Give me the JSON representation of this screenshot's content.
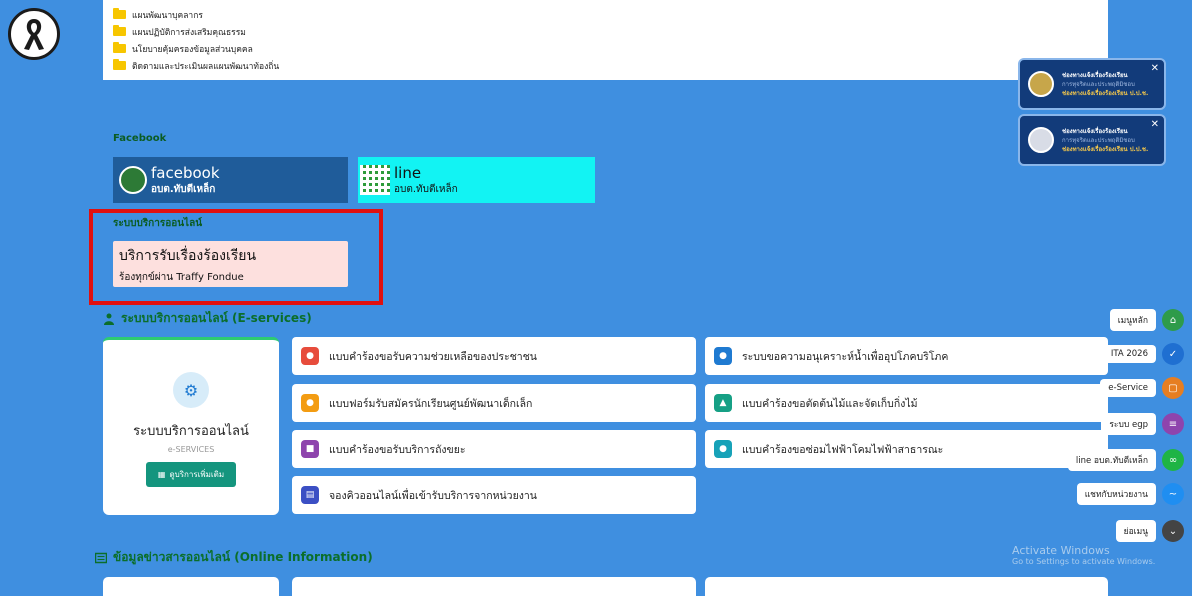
{
  "documents": [
    "แผนพัฒนาบุคลากร",
    "แผนปฏิบัติการส่งเสริมคุณธรรม",
    "นโยบายคุ้มครองข้อมูลส่วนบุคคล",
    "ติดตามและประเมินผลแผนพัฒนาท้องถิ่น"
  ],
  "facebook_section": {
    "label": "Facebook",
    "facebook_title": "facebook",
    "facebook_sub": "อบต.ทับตีเหล็ก",
    "line_title": "line",
    "line_sub": "อบต.ทับตีเหล็ก"
  },
  "online_service": {
    "label": "ระบบบริการออนไลน์",
    "traffy_title": "บริการรับเรื่องร้องเรียน",
    "traffy_sub": "ร้องทุกข์ผ่าน Traffy Fondue"
  },
  "eservices": {
    "heading": "ระบบบริการออนไลน์ (E-services)",
    "card_title": "ระบบบริการออนไลน์",
    "card_sub": "e-SERVICES",
    "more_button": "ดูบริการเพิ่มเติม",
    "items": [
      {
        "label": "แบบคำร้องขอรับความช่วยเหลือของประชาชน",
        "color": "#e74c3c"
      },
      {
        "label": "ระบบขอความอนุเคราะห์น้ำเพื่ออุปโภคบริโภค",
        "color": "#1f7ad1"
      },
      {
        "label": "แบบฟอร์มรับสมัครนักเรียนศูนย์พัฒนาเด็กเล็ก",
        "color": "#f39c12"
      },
      {
        "label": "แบบคำร้องขอตัดต้นไม้และจัดเก็บกิ่งไม้",
        "color": "#16a085"
      },
      {
        "label": "แบบคำร้องขอรับบริการถังขยะ",
        "color": "#8e44ad"
      },
      {
        "label": "แบบคำร้องขอซ่อมไฟฟ้าโคมไฟฟ้าสาธารณะ",
        "color": "#17a2b8"
      },
      {
        "label": "จองคิวออนไลน์เพื่อเข้ารับบริการจากหน่วยงาน",
        "color": "#3b4fc4"
      }
    ]
  },
  "info_section": {
    "heading": "ข้อมูลข่าวสารออนไลน์ (Online Information)"
  },
  "notifications": [
    {
      "title": "ช่องทางแจ้งเรื่องร้องเรียน",
      "sub": "การทุจริตและประพฤติมิชอบ",
      "link": "ช่องทางแจ้งเรื่องร้องเรียน ป.ป.ช."
    },
    {
      "title": "ช่องทางแจ้งเรื่องร้องเรียน",
      "sub": "การทุจริตและประพฤติมิชอบ",
      "link": "ช่องทางแจ้งเรื่องร้องเรียน ป.ป.ช."
    }
  ],
  "side_menu": [
    {
      "label": "เมนูหลัก",
      "icon": "home-icon",
      "color": "#2e9b4a"
    },
    {
      "label": "ITA 2026",
      "icon": "check-icon",
      "color": "#1f6fd1"
    },
    {
      "label": "e-Service",
      "icon": "chat-icon",
      "color": "#e67e22"
    },
    {
      "label": "ระบบ egp",
      "icon": "list-icon",
      "color": "#8e44ad"
    },
    {
      "label": "line อบต.ทับตีเหล็ก",
      "icon": "link-icon",
      "color": "#1fb445"
    },
    {
      "label": "แชทกับหน่วยงาน",
      "icon": "messenger-icon",
      "color": "#1f8ef1"
    },
    {
      "label": "ย่อเมนู",
      "icon": "chevron-down-icon",
      "color": "#444"
    }
  ],
  "watermark": {
    "line1": "Activate Windows",
    "line2": "Go to Settings to activate Windows."
  }
}
